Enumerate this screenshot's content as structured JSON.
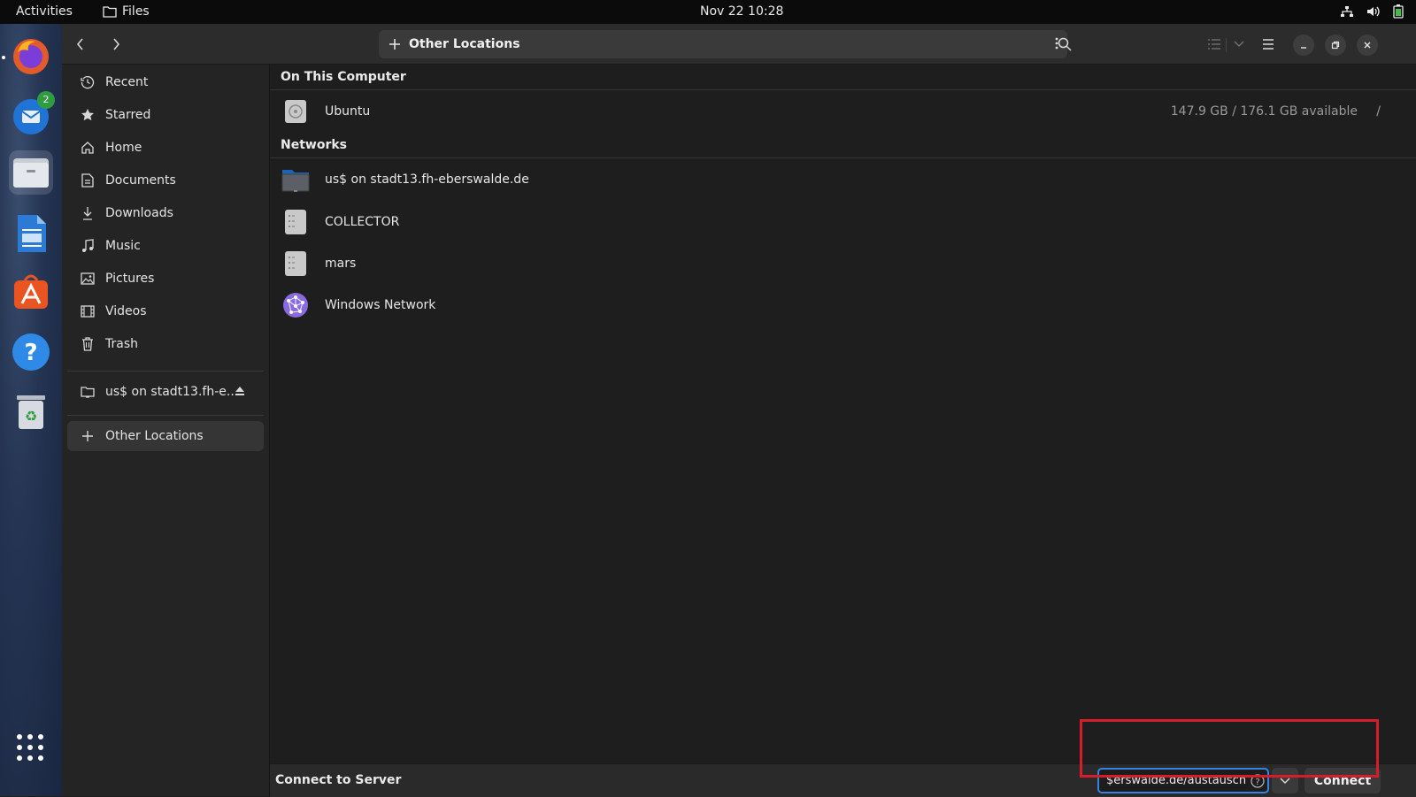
{
  "topbar": {
    "activities": "Activities",
    "app_name": "Files",
    "clock": "Nov 22  10:28",
    "tray_icons": [
      "network-icon",
      "volume-icon",
      "battery-icon"
    ]
  },
  "dock": {
    "apps": [
      {
        "name": "Firefox",
        "icon": "firefox-icon",
        "running": true
      },
      {
        "name": "Thunderbird",
        "icon": "thunderbird-icon",
        "badge": "2"
      },
      {
        "name": "Files",
        "icon": "files-icon",
        "active": true
      },
      {
        "name": "LibreOffice Writer",
        "icon": "writer-icon"
      },
      {
        "name": "Ubuntu Software",
        "icon": "software-icon"
      },
      {
        "name": "Help",
        "icon": "help-icon"
      },
      {
        "name": "Trash",
        "icon": "trash-icon"
      }
    ],
    "show_apps_icon": "app-grid-icon"
  },
  "headerbar": {
    "location": "Other Locations"
  },
  "sidebar": {
    "items": [
      {
        "label": "Recent",
        "icon": "clock-icon"
      },
      {
        "label": "Starred",
        "icon": "star-icon"
      },
      {
        "label": "Home",
        "icon": "home-icon"
      },
      {
        "label": "Documents",
        "icon": "document-icon"
      },
      {
        "label": "Downloads",
        "icon": "download-icon"
      },
      {
        "label": "Music",
        "icon": "music-icon"
      },
      {
        "label": "Pictures",
        "icon": "picture-icon"
      },
      {
        "label": "Videos",
        "icon": "video-icon"
      },
      {
        "label": "Trash",
        "icon": "trash-icon"
      }
    ],
    "mount": {
      "label": "us$ on stadt13.fh-e...",
      "icon": "folder-icon"
    },
    "other_locations": {
      "label": "Other Locations",
      "icon": "plus-icon"
    }
  },
  "main": {
    "on_this_computer": {
      "title": "On This Computer",
      "items": [
        {
          "name": "Ubuntu",
          "info": "147.9 GB / 176.1 GB available",
          "path": "/"
        }
      ]
    },
    "networks": {
      "title": "Networks",
      "items": [
        {
          "name": "us$ on stadt13.fh-eberswalde.de",
          "icon": "network-folder-icon"
        },
        {
          "name": "COLLECTOR",
          "icon": "server-icon"
        },
        {
          "name": "mars",
          "icon": "server-icon"
        },
        {
          "name": "Windows Network",
          "icon": "windows-network-icon"
        }
      ]
    }
  },
  "connect_bar": {
    "title": "Connect to Server",
    "server_address": "erswalde.de/austausch$",
    "connect_label": "Connect"
  }
}
